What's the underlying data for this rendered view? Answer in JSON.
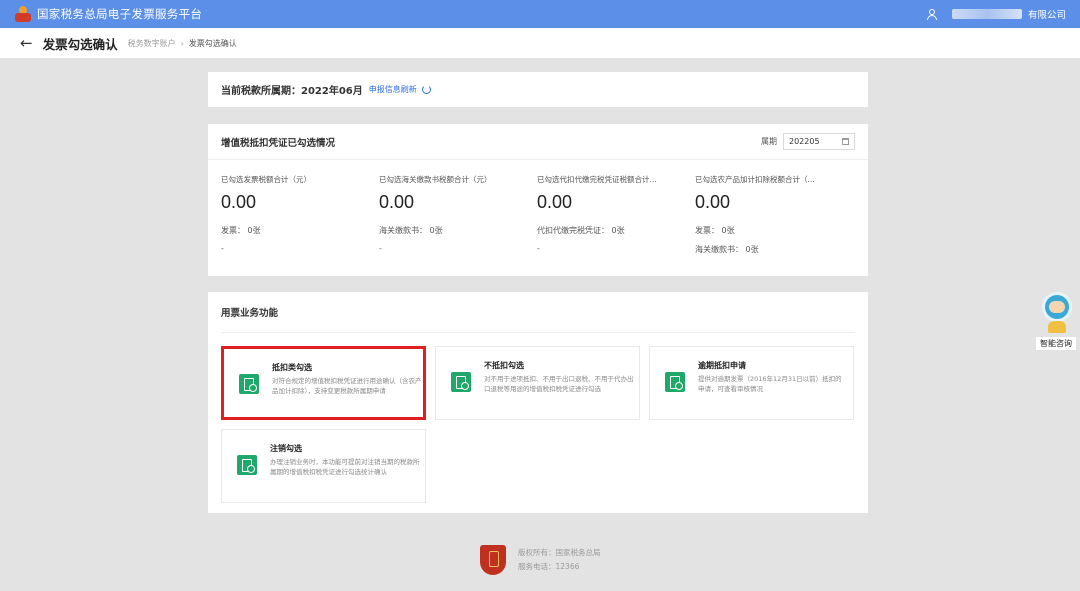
{
  "header": {
    "site_title": "国家税务总局电子发票服务平台",
    "user_suffix": "有限公司"
  },
  "nav": {
    "back_label": "←",
    "page_title": "发票勾选确认",
    "breadcrumb": [
      "税务数字账户",
      "发票勾选确认"
    ],
    "breadcrumb_sep": "›"
  },
  "period": {
    "label": "当前税款所属期：2022年06月",
    "refresh_link": "申报信息刷新"
  },
  "stats": {
    "title": "增值税抵扣凭证已勾选情况",
    "picker_label": "属期",
    "picker_value": "202205",
    "items": [
      {
        "label": "已勾选发票税额合计（元）",
        "value": "0.00",
        "sub": "发票：  0张",
        "sub2": "-"
      },
      {
        "label": "已勾选海关缴款书税额合计（元）",
        "value": "0.00",
        "sub": "海关缴款书：  0张",
        "sub2": "-"
      },
      {
        "label": "已勾选代扣代缴完税凭证税额合计...",
        "value": "0.00",
        "sub": "代扣代缴完税凭证：  0张",
        "sub2": "-"
      },
      {
        "label": "已勾选农产品加计扣除税额合计（...",
        "value": "0.00",
        "sub": "发票：  0张",
        "sub2": "海关缴款书：  0张"
      }
    ]
  },
  "functions": {
    "title": "用票业务功能",
    "tiles": [
      {
        "name": "抵扣类勾选",
        "desc": "对符合规定的增值税扣税凭证进行用途确认（含农产品加计扣除），支持变更税款所属期申请"
      },
      {
        "name": "不抵扣勾选",
        "desc": "对不用于进项抵扣、不用于出口退税、不用于代办出口退税等用途的增值税扣税凭证进行勾选"
      },
      {
        "name": "逾期抵扣申请",
        "desc": "提供对逾期发票（2016年12月31日以前）抵扣的申请，可查看审核情况"
      },
      {
        "name": "注销勾选",
        "desc": "办理注销业务时，本功能可提前对注销当期的税款所属期的增值税扣税凭证进行勾选统计确认"
      }
    ]
  },
  "footer": {
    "copyright": "版权所有：国家税务总局",
    "phone": "服务电话：12366"
  },
  "assistant": {
    "label": "智能咨询"
  },
  "colors": {
    "topbar": "#5b8fe8",
    "accent_link": "#2f6fe0",
    "tile_icon": "#20a86a",
    "highlight": "#e02020"
  }
}
